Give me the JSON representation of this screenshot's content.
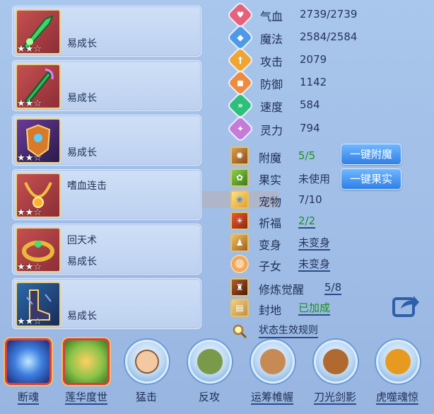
{
  "equipment": [
    {
      "slot": "weapon-1",
      "stars": 2,
      "skill": "",
      "trait": "易成长"
    },
    {
      "slot": "weapon-2",
      "stars": 2,
      "skill": "",
      "trait": "易成长"
    },
    {
      "slot": "armor-1",
      "stars": 2,
      "skill": "",
      "trait": "易成长"
    },
    {
      "slot": "necklace",
      "stars": 2,
      "skill": "嗜血连击",
      "trait": ""
    },
    {
      "slot": "bracelet",
      "stars": 2,
      "skill": "回天术",
      "trait": "易成长"
    },
    {
      "slot": "armor-2",
      "stars": 2,
      "skill": "",
      "trait": "易成长"
    }
  ],
  "stats": [
    {
      "label": "气血",
      "value": "2739/2739",
      "color": "#e8607a",
      "icon": "heart-icon"
    },
    {
      "label": "魔法",
      "value": "2584/2584",
      "color": "#4f9ae8",
      "icon": "mana-icon"
    },
    {
      "label": "攻击",
      "value": "2079",
      "color": "#f0a431",
      "icon": "sword-icon"
    },
    {
      "label": "防御",
      "value": "1142",
      "color": "#f08a3c",
      "icon": "shield-icon"
    },
    {
      "label": "速度",
      "value": "584",
      "color": "#2cc07a",
      "icon": "speed-icon"
    },
    {
      "label": "灵力",
      "value": "794",
      "color": "#c77bd8",
      "icon": "spirit-icon"
    }
  ],
  "status": {
    "enchant": {
      "label": "附魔",
      "value": "5/5",
      "button": "一键附魔"
    },
    "fruit": {
      "label": "果实",
      "value": "未使用",
      "button": "一键果实"
    },
    "pet": {
      "label": "宠物",
      "value": "7/10"
    },
    "blessing": {
      "label": "祈福",
      "value": "2/2"
    },
    "transform": {
      "label": "变身",
      "value": "未变身"
    },
    "child": {
      "label": "子女",
      "value": "未变身"
    },
    "cultivation": {
      "label": "修炼觉醒",
      "value": "5/8"
    },
    "fief": {
      "label": "封地",
      "value": "已加成"
    },
    "rules": {
      "label": "状态生效规则"
    }
  },
  "skills": [
    {
      "name": "断魂",
      "frame": "square",
      "color": "#3f7fe0",
      "underline": true
    },
    {
      "name": "莲华度世",
      "frame": "square",
      "color": "#8bc34a",
      "underline": true
    },
    {
      "name": "猛击",
      "frame": "round",
      "color": "#f2c9a0",
      "underline": false
    },
    {
      "name": "反攻",
      "frame": "round",
      "color": "#7a9a4a",
      "underline": false
    },
    {
      "name": "运筹帷幄",
      "frame": "round",
      "color": "#c88a55",
      "underline": true
    },
    {
      "name": "刀光剑影",
      "frame": "round",
      "color": "#b06a30",
      "underline": true
    },
    {
      "name": "虎噬魂惊",
      "frame": "round",
      "color": "#e79a20",
      "underline": true
    }
  ],
  "colors": {
    "background": "#a9c6ec",
    "green_value": "#1c8f1c",
    "button_blue": "#2f7fe6"
  }
}
